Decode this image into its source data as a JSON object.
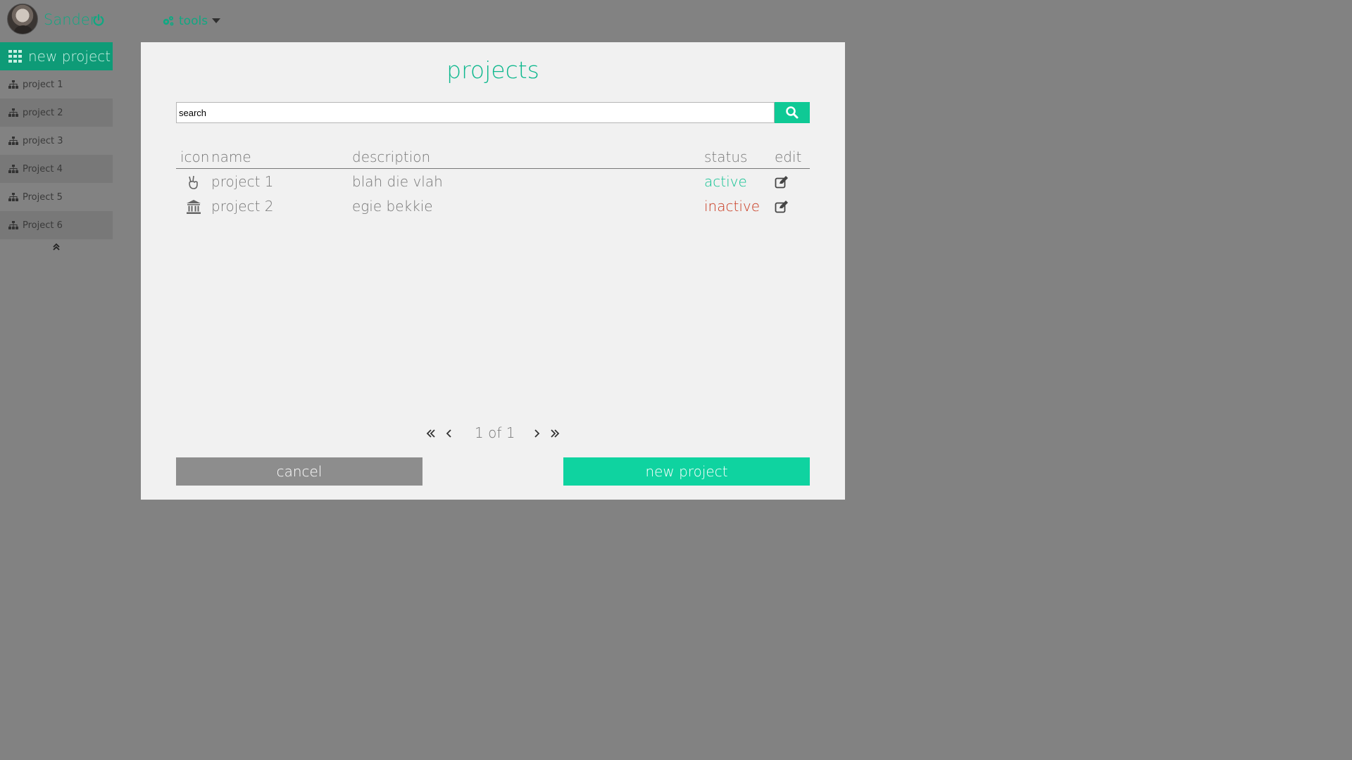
{
  "user": {
    "name": "Sander"
  },
  "toolbar": {
    "tools_label": "tools"
  },
  "sidebar": {
    "new_project_label": "new project",
    "items": [
      {
        "label": "project 1"
      },
      {
        "label": "project 2"
      },
      {
        "label": "project 3"
      },
      {
        "label": "Project 4"
      },
      {
        "label": "Project 5"
      },
      {
        "label": "Project 6"
      }
    ]
  },
  "modal": {
    "title": "projects",
    "search": {
      "value": "search"
    },
    "columns": {
      "icon": "icon",
      "name": "name",
      "description": "description",
      "status": "status",
      "edit": "edit"
    },
    "rows": [
      {
        "icon": "peace-hand-icon",
        "name": "project 1",
        "description": "blah die vlah",
        "status": "active"
      },
      {
        "icon": "bank-icon",
        "name": "project 2",
        "description": "egie bekkie",
        "status": "inactive"
      }
    ],
    "pagination": {
      "info": "1 of 1"
    },
    "cancel_label": "cancel",
    "new_project_label": "new project"
  },
  "colors": {
    "accent": "#0fd3a0",
    "brand_dark": "#0e9b77",
    "status_active": "#11c292",
    "status_inactive": "#c8391f",
    "backdrop": "#828282"
  }
}
